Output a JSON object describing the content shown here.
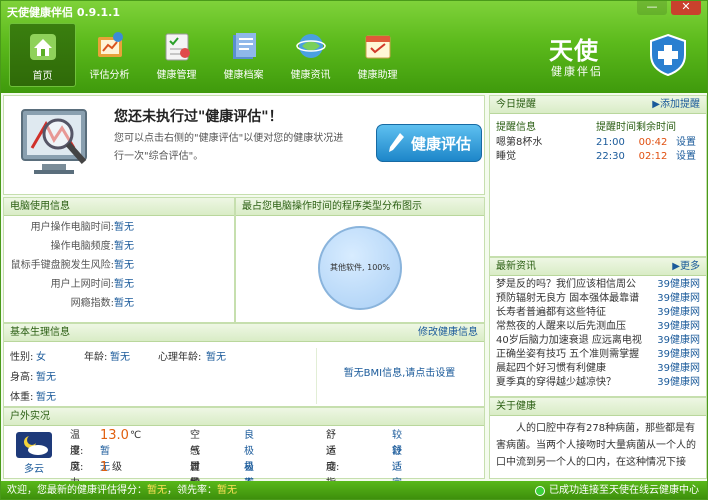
{
  "app": {
    "title": "天使健康伴侣 0.9.1.1",
    "logo_main": "天使",
    "logo_sub": "健康伴侣",
    "window_buttons": [
      "—",
      "✕"
    ]
  },
  "nav": [
    {
      "label": "首页",
      "icon": "home-icon",
      "active": true
    },
    {
      "label": "评估分析",
      "icon": "analysis-icon"
    },
    {
      "label": "健康管理",
      "icon": "management-icon"
    },
    {
      "label": "健康档案",
      "icon": "archive-icon"
    },
    {
      "label": "健康资讯",
      "icon": "news-icon"
    },
    {
      "label": "健康助理",
      "icon": "assistant-icon"
    }
  ],
  "banner": {
    "title": "您还未执行过\"健康评估\"！",
    "text": "您可以点击右侧的\"健康评估\"以便对您的健康状况进行一次\"综合评估\"。",
    "button": "健康评估"
  },
  "pc_usage": {
    "title": "电脑使用信息",
    "rows": [
      {
        "label": "用户操作电脑时间:",
        "value": "暂无"
      },
      {
        "label": "操作电脑频度:",
        "value": "暂无"
      },
      {
        "label": "鼠标手键盘腕发生风险:",
        "value": "暂无"
      },
      {
        "label": "用户上网时间:",
        "value": "暂无"
      },
      {
        "label": "网瘾指数:",
        "value": "暂无"
      }
    ]
  },
  "pc_chart": {
    "title": "最占您电脑操作时间的程序类型分布图示",
    "slice_label": "其他软件, 100%"
  },
  "basic": {
    "title": "基本生理信息",
    "edit": "修改健康信息",
    "gender_label": "性别:",
    "gender": "女",
    "age_label": "年龄:",
    "age": "暂无",
    "mental_age_label": "心理年龄:",
    "mental_age": "暂无",
    "height_label": "身高:",
    "height": "暂无",
    "weight_label": "体重:",
    "weight": "暂无",
    "bmi_msg": "暂无BMI信息,请点击设置"
  },
  "outdoor": {
    "title": "户外实况",
    "weather": "多云",
    "temp_label": "温度:",
    "temp": "13.0",
    "temp_unit": "℃",
    "humidity_label": "湿度:",
    "humidity": "暂无",
    "wind_label": "风力:",
    "wind": "1",
    "wind_unit": "级",
    "air_label": "空气质量:",
    "air": "良",
    "cold_label": "感冒指数:",
    "cold": "极易发",
    "allergy_label": "过敏指数:",
    "allergy": "极不易发",
    "comfort_label": "舒适度:",
    "comfort": "较舒适",
    "sport_label": "运动指数:",
    "sport": "较适宜"
  },
  "reminder": {
    "title": "今日提醒",
    "add": "添加提醒",
    "headers": [
      "提醒信息",
      "提醒时间",
      "剩余时间"
    ],
    "rows": [
      {
        "info": "嗯第8杯水",
        "time": "21:00",
        "remain": "00:42",
        "action": "设置"
      },
      {
        "info": "睡觉",
        "time": "22:30",
        "remain": "02:12",
        "action": "设置"
      }
    ]
  },
  "news": {
    "title": "最新资讯",
    "more": "更多",
    "items": [
      {
        "text": "梦是反的吗？我们应该相信周公",
        "source": "39健康网"
      },
      {
        "text": "预防辐射无良方 固本强体最靠谱",
        "source": "39健康网"
      },
      {
        "text": "长寿者普遍都有这些特征",
        "source": "39健康网"
      },
      {
        "text": "常熬夜的人醒来以后先测血压",
        "source": "39健康网"
      },
      {
        "text": "40岁后脑力加速衰退 应远离电视",
        "source": "39健康网"
      },
      {
        "text": "正确坐姿有技巧 五个准则需掌握",
        "source": "39健康网"
      },
      {
        "text": "晨起四个好习惯有利健康",
        "source": "39健康网"
      },
      {
        "text": "夏季真的穿得越少越凉快？",
        "source": "39健康网"
      }
    ]
  },
  "about": {
    "title": "关于健康",
    "text": "人的口腔中存有278种病菌，那些都是有害病菌。当两个人接吻时大量病菌从一个人的口中流到另一个人的口内，在这种情况下接"
  },
  "status": {
    "left_prefix": "欢迎，您最新的健康评估得分：",
    "score": "暂无",
    "lead_prefix": "，领先率：",
    "lead": "暂无",
    "right": "已成功连接至天使在线云健康中心"
  }
}
